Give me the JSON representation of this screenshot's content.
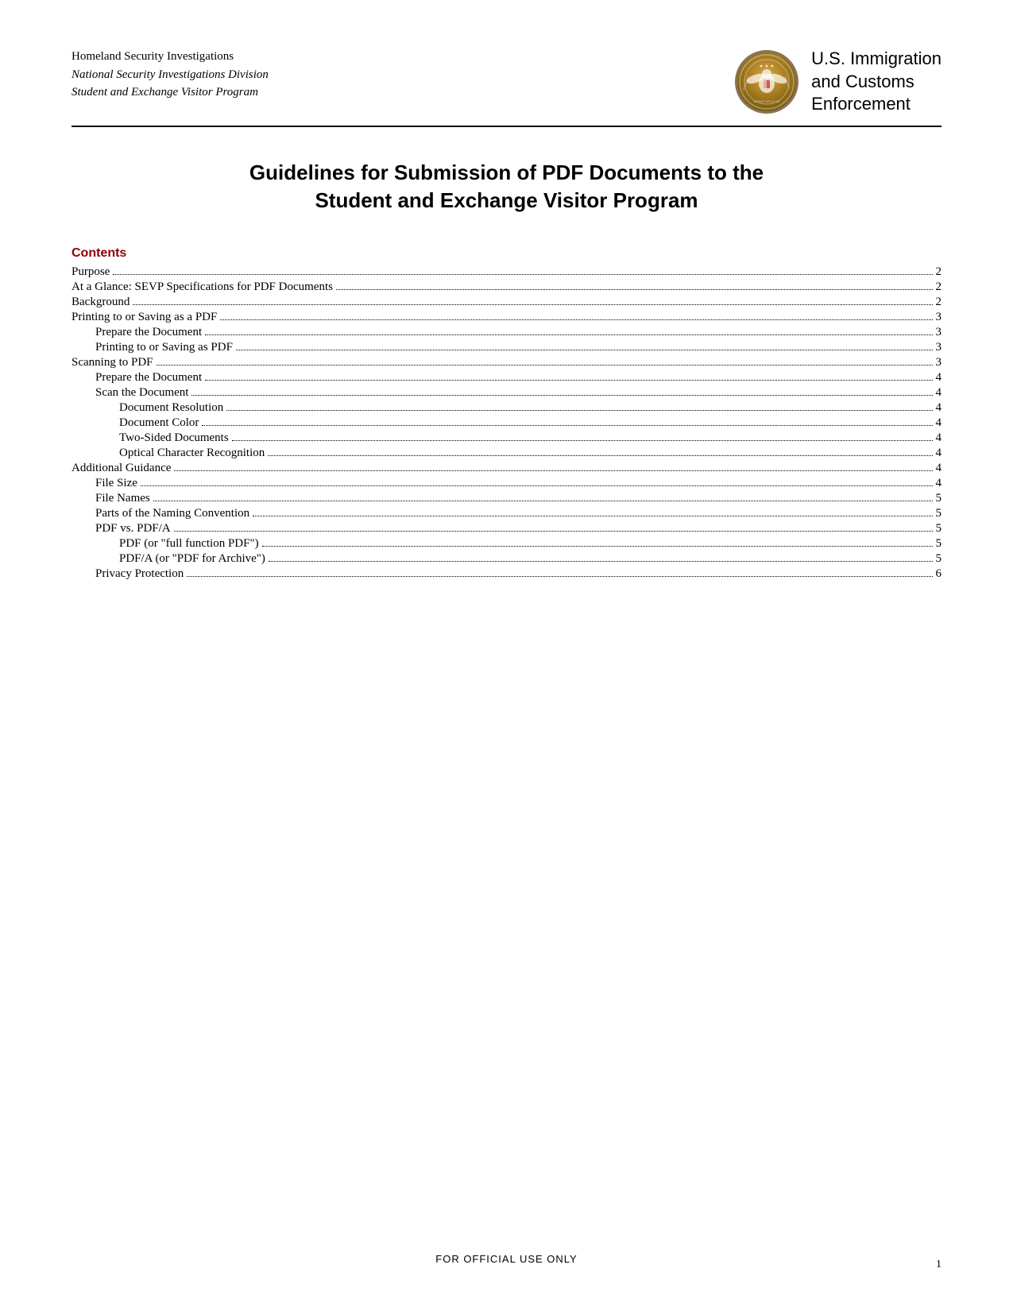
{
  "header": {
    "left": {
      "line1": "Homeland Security Investigations",
      "line2": "National Security Investigations Division",
      "line3": "Student and Exchange Visitor Program"
    },
    "agency": {
      "line1": "U.S. Immigration",
      "line2": "and Customs",
      "line3": "Enforcement"
    },
    "seal_alt": "DHS Seal"
  },
  "main_title": {
    "line1": "Guidelines for Submission of PDF Documents to the",
    "line2": "Student and Exchange Visitor Program"
  },
  "contents": {
    "label": "Contents",
    "items": [
      {
        "text": "Purpose",
        "indent": 0,
        "page": "2"
      },
      {
        "text": "At a Glance: SEVP Specifications for PDF Documents",
        "indent": 0,
        "page": "2"
      },
      {
        "text": "Background",
        "indent": 0,
        "page": "2"
      },
      {
        "text": "Printing to or Saving as a PDF",
        "indent": 0,
        "page": "3"
      },
      {
        "text": "Prepare the Document",
        "indent": 1,
        "page": "3"
      },
      {
        "text": "Printing to or Saving as PDF",
        "indent": 1,
        "page": "3"
      },
      {
        "text": "Scanning to PDF",
        "indent": 0,
        "page": "3"
      },
      {
        "text": "Prepare the Document",
        "indent": 1,
        "page": "4"
      },
      {
        "text": "Scan the Document",
        "indent": 1,
        "page": "4"
      },
      {
        "text": "Document Resolution",
        "indent": 2,
        "page": "4"
      },
      {
        "text": "Document Color",
        "indent": 2,
        "page": "4"
      },
      {
        "text": "Two-Sided Documents",
        "indent": 2,
        "page": "4"
      },
      {
        "text": "Optical Character Recognition",
        "indent": 2,
        "page": "4"
      },
      {
        "text": "Additional Guidance",
        "indent": 0,
        "page": "4"
      },
      {
        "text": "File Size",
        "indent": 1,
        "page": "4"
      },
      {
        "text": "File Names",
        "indent": 1,
        "page": "5"
      },
      {
        "text": "Parts of the Naming Convention",
        "indent": 1,
        "page": "5"
      },
      {
        "text": "PDF vs. PDF/A",
        "indent": 1,
        "page": "5"
      },
      {
        "text": "PDF (or \"full function PDF\")",
        "indent": 2,
        "page": "5"
      },
      {
        "text": "PDF/A (or \"PDF for Archive\")",
        "indent": 2,
        "page": "5"
      },
      {
        "text": "Privacy Protection",
        "indent": 1,
        "page": "6"
      }
    ]
  },
  "footer": {
    "official_text": "FOR OFFICIAL USE ONLY",
    "page_number": "1"
  }
}
